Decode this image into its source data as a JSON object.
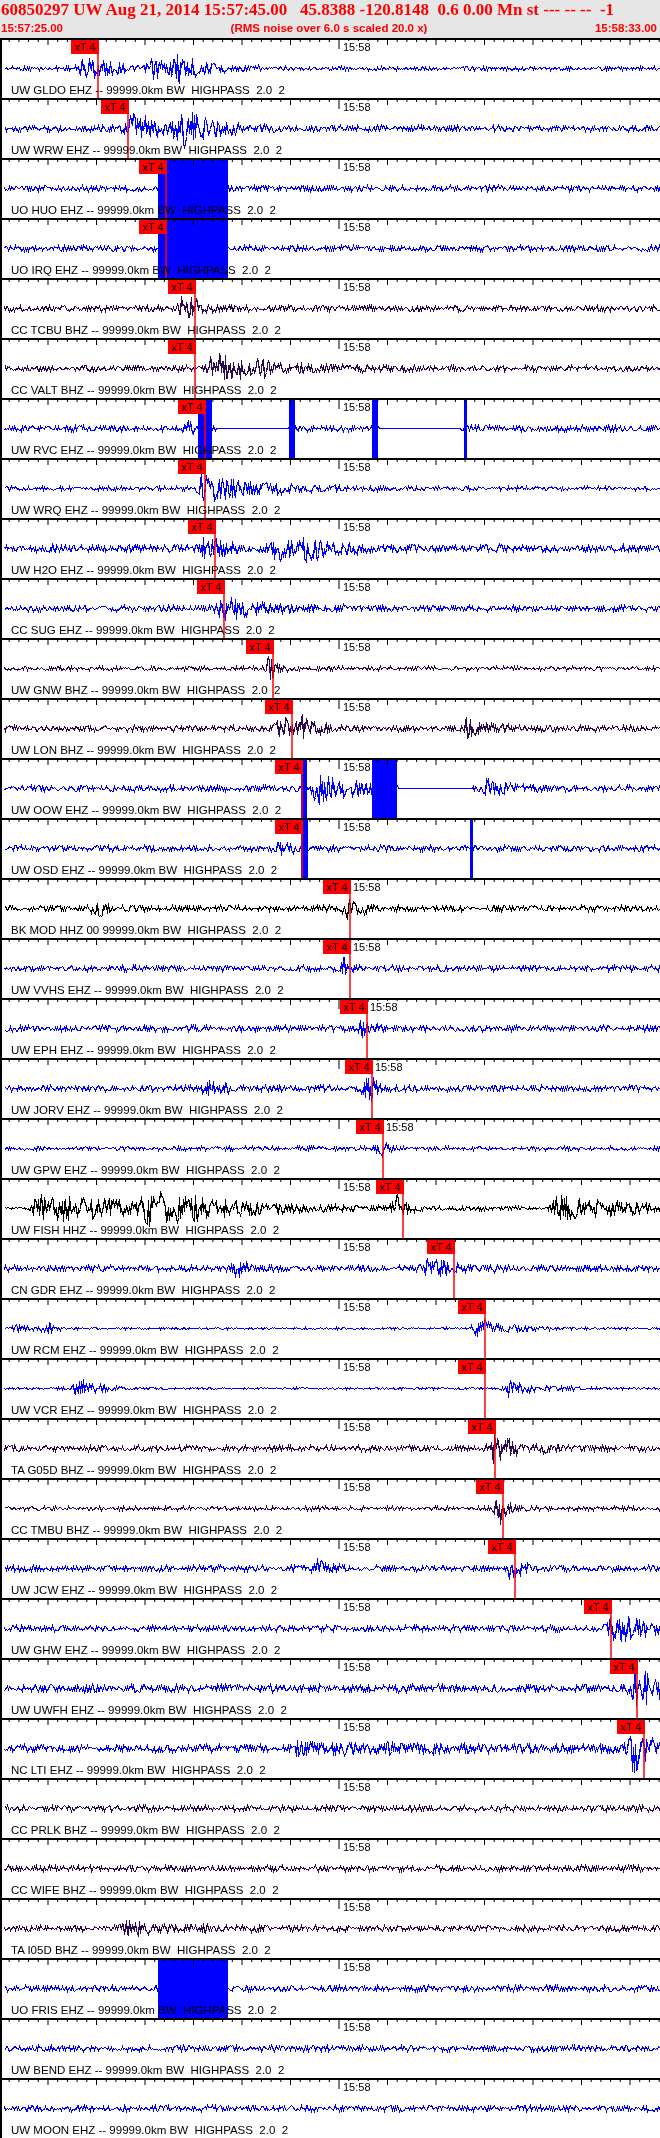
{
  "header": {
    "title": "60850297 UW Aug 21, 2014 15:57:45.00   45.8388 -120.8148  0.6 0.00 Mn st --- -- --  -1",
    "start_time": "15:57:25.00",
    "note": "(RMS noise over 6.0 s scaled 20.0 x)",
    "end_time": "15:58:33.00"
  },
  "traces": [
    {
      "label": "UW GLDO EHZ -- 99999.0km BW  HIGHPASS  2.0  2",
      "time_mark": "15:58",
      "color": "#0000ff",
      "pick": "xT 4"
    },
    {
      "label": "UW WRW EHZ -- 99999.0km BW  HIGHPASS  2.0  2",
      "time_mark": "15:58",
      "color": "#0000ff",
      "pick": "xT 4"
    },
    {
      "label": "UO HUO EHZ -- 99999.0km BW  HIGHPASS  2.0  2",
      "time_mark": "15:58",
      "color": "#0000ff",
      "pick": "xT 4"
    },
    {
      "label": "UO IRQ EHZ -- 99999.0km BW  HIGHPASS  2.0  2",
      "time_mark": "15:58",
      "color": "#0000ff",
      "pick": "xT 4"
    },
    {
      "label": "CC TCBU BHZ -- 99999.0km BW  HIGHPASS  2.0  2",
      "time_mark": "15:58",
      "color": "#2a0a50",
      "pick": "xT 4"
    },
    {
      "label": "CC VALT BHZ -- 99999.0km BW  HIGHPASS  2.0  2",
      "time_mark": "15:58",
      "color": "#2a0a50",
      "pick": "xT 4"
    },
    {
      "label": "UW RVC EHZ -- 99999.0km BW  HIGHPASS  2.0  2",
      "time_mark": "15:58",
      "color": "#0000ff",
      "pick": "xT 4"
    },
    {
      "label": "UW WRQ EHZ -- 99999.0km BW  HIGHPASS  2.0  2",
      "time_mark": "15:58",
      "color": "#0000ff",
      "pick": "xT 4"
    },
    {
      "label": "UW H2O EHZ -- 99999.0km BW  HIGHPASS  2.0  2",
      "time_mark": "15:58",
      "color": "#0000ff",
      "pick": "xT 4"
    },
    {
      "label": "CC SUG EHZ -- 99999.0km BW  HIGHPASS  2.0  2",
      "time_mark": "15:58",
      "color": "#0000ff",
      "pick": "xT 4"
    },
    {
      "label": "UW GNW BHZ -- 99999.0km BW  HIGHPASS  2.0  2",
      "time_mark": "15:58",
      "color": "#2a0a50",
      "pick": "xT 4"
    },
    {
      "label": "UW LON BHZ -- 99999.0km BW  HIGHPASS  2.0  2",
      "time_mark": "15:58",
      "color": "#2a0a50",
      "pick": "xT 4"
    },
    {
      "label": "UW OOW EHZ -- 99999.0km BW  HIGHPASS  2.0  2",
      "time_mark": "15:58",
      "color": "#0000ff",
      "pick": "xT 4"
    },
    {
      "label": "UW OSD EHZ -- 99999.0km BW  HIGHPASS  2.0  2",
      "time_mark": "15:58",
      "color": "#0000ff",
      "pick": "xT 4"
    },
    {
      "label": "BK MOD HHZ 00 99999.0km BW  HIGHPASS  2.0  2",
      "time_mark": "15:58",
      "color": "#000000",
      "pick": "xT 4"
    },
    {
      "label": "UW VVHS EHZ -- 99999.0km BW  HIGHPASS  2.0  2",
      "time_mark": "15:58",
      "color": "#0000ff",
      "pick": "xT 4"
    },
    {
      "label": "UW EPH EHZ -- 99999.0km BW  HIGHPASS  2.0  2",
      "time_mark": "15:58",
      "color": "#0000ff",
      "pick": "xT 4"
    },
    {
      "label": "UW JORV EHZ -- 99999.0km BW  HIGHPASS  2.0  2",
      "time_mark": "15:58",
      "color": "#0000ff",
      "pick": "xT 4"
    },
    {
      "label": "UW GPW EHZ -- 99999.0km BW  HIGHPASS  2.0  2",
      "time_mark": "15:58",
      "color": "#0000ff",
      "pick": "xT 4"
    },
    {
      "label": "UW FISH HHZ -- 99999.0km BW  HIGHPASS  2.0  2",
      "time_mark": "15:58",
      "color": "#000000",
      "pick": "xT 4"
    },
    {
      "label": "CN GDR EHZ -- 99999.0km BW  HIGHPASS  2.0  2",
      "time_mark": "15:58",
      "color": "#0000ff",
      "pick": "xT 4"
    },
    {
      "label": "UW RCM EHZ -- 99999.0km BW  HIGHPASS  2.0  2",
      "time_mark": "15:58",
      "color": "#0000ff",
      "pick": "xT 4"
    },
    {
      "label": "UW VCR EHZ -- 99999.0km BW  HIGHPASS  2.0  2",
      "time_mark": "15:58",
      "color": "#0000ff",
      "pick": "xT 4"
    },
    {
      "label": "TA G05D BHZ -- 99999.0km BW  HIGHPASS  2.0  2",
      "time_mark": "15:58",
      "color": "#2a0a50",
      "pick": "xT 4"
    },
    {
      "label": "CC TMBU BHZ -- 99999.0km BW  HIGHPASS  2.0  2",
      "time_mark": "15:58",
      "color": "#2a0a50",
      "pick": "xT 4"
    },
    {
      "label": "UW JCW EHZ -- 99999.0km BW  HIGHPASS  2.0  2",
      "time_mark": "15:58",
      "color": "#0000ff",
      "pick": "xT 4"
    },
    {
      "label": "UW GHW EHZ -- 99999.0km BW  HIGHPASS  2.0  2",
      "time_mark": "15:58",
      "color": "#0000ff",
      "pick": "xT 4"
    },
    {
      "label": "UW UWFH EHZ -- 99999.0km BW  HIGHPASS  2.0  2",
      "time_mark": "15:58",
      "color": "#0000ff",
      "pick": "xT 4"
    },
    {
      "label": "NC LTI EHZ -- 99999.0km BW  HIGHPASS  2.0  2",
      "time_mark": "15:58",
      "color": "#0000ff",
      "pick": "xT 4"
    },
    {
      "label": "CC PRLK BHZ -- 99999.0km BW  HIGHPASS  2.0  2",
      "time_mark": "15:58",
      "color": "#2a0a50"
    },
    {
      "label": "CC WIFE BHZ -- 99999.0km BW  HIGHPASS  2.0  2",
      "time_mark": "15:58",
      "color": "#2a0a50"
    },
    {
      "label": "TA I05D BHZ -- 99999.0km BW  HIGHPASS  2.0  2",
      "time_mark": "15:58",
      "color": "#2a0a50"
    },
    {
      "label": "UO FRIS EHZ -- 99999.0km BW  HIGHPASS  2.0  2",
      "time_mark": "15:58",
      "color": "#0000ff"
    },
    {
      "label": "UW BEND EHZ -- 99999.0km BW  HIGHPASS  2.0  2",
      "time_mark": "15:58",
      "color": "#0000ff"
    },
    {
      "label": "UW MOON EHZ -- 99999.0km BW  HIGHPASS  2.0  2",
      "time_mark": "15:58",
      "color": "#0000ff"
    }
  ]
}
